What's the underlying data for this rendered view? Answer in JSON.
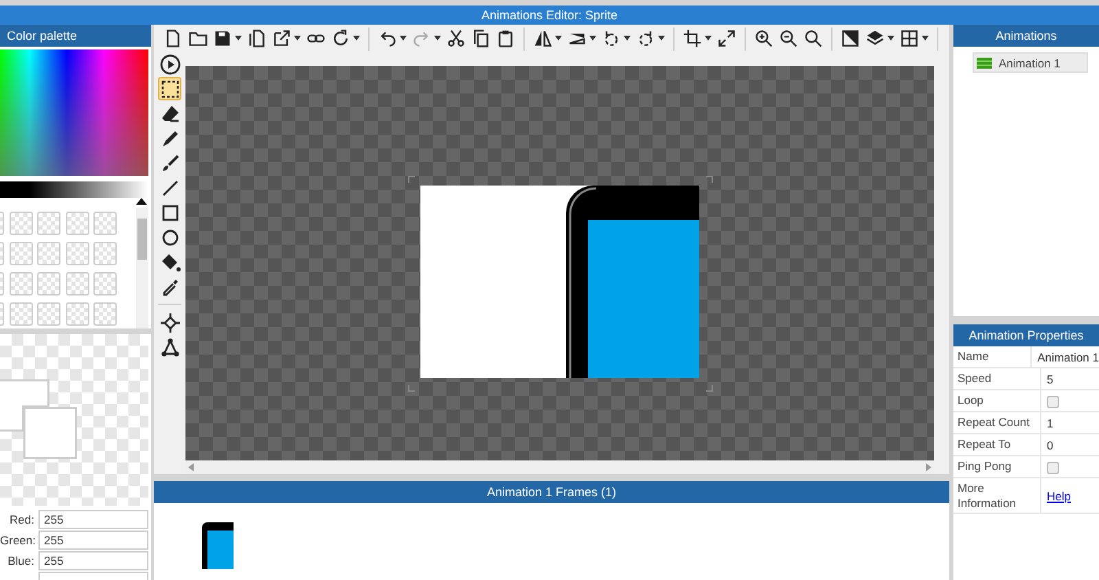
{
  "window": {
    "title": "Animations Editor: Sprite"
  },
  "color_palette": {
    "title": "Color palette",
    "brightness": {
      "level": 1
    },
    "fields": [
      {
        "label": "Red:",
        "value": "255"
      },
      {
        "label": "Green:",
        "value": "255"
      },
      {
        "label": "Blue:",
        "value": "255"
      }
    ]
  },
  "tools": [
    {
      "kind": "play",
      "selected": false
    },
    {
      "kind": "select",
      "selected": true
    },
    {
      "kind": "eraser",
      "selected": false
    },
    {
      "kind": "pencil",
      "selected": false
    },
    {
      "kind": "brush",
      "selected": false
    },
    {
      "kind": "line",
      "selected": false
    },
    {
      "kind": "rectangle",
      "selected": false
    },
    {
      "kind": "ellipse",
      "selected": false
    },
    {
      "kind": "fill",
      "selected": false
    },
    {
      "kind": "picker",
      "selected": false
    },
    {
      "kind": "point",
      "selected": false
    },
    {
      "kind": "nodes",
      "selected": false
    }
  ],
  "frames_panel": {
    "title": "Animation 1 Frames (1)"
  },
  "animations_panel": {
    "title": "Animations",
    "items": [
      {
        "label": "Animation 1",
        "selected": true
      }
    ]
  },
  "properties": {
    "title": "Animation Properties",
    "rows": [
      {
        "kind": "text",
        "label": "Name",
        "value": "Animation 1"
      },
      {
        "kind": "text",
        "label": "Speed",
        "value": "5"
      },
      {
        "kind": "checkbox",
        "label": "Loop",
        "checked": false
      },
      {
        "kind": "text",
        "label": "Repeat Count",
        "value": "1"
      },
      {
        "kind": "text",
        "label": "Repeat To",
        "value": "0"
      },
      {
        "kind": "checkbox",
        "label": "Ping Pong",
        "checked": false
      },
      {
        "kind": "link",
        "label": "More Information",
        "value": "Help"
      }
    ]
  }
}
